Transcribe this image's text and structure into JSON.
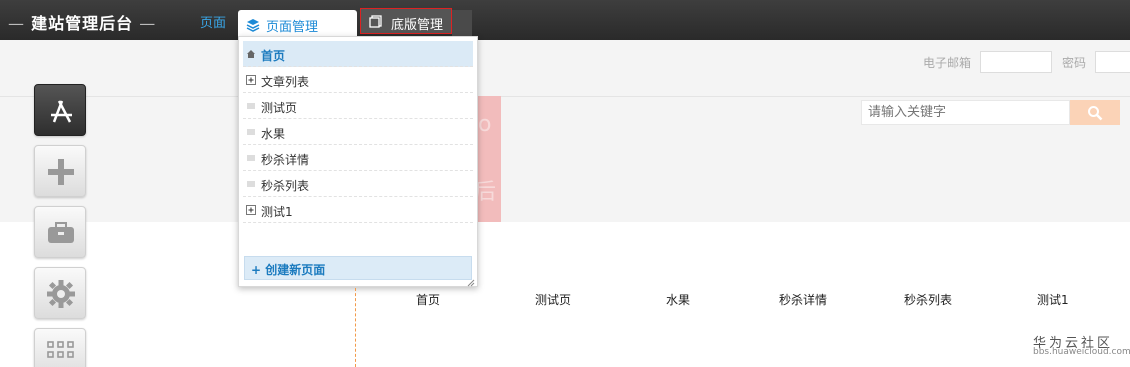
{
  "header": {
    "app_title": "建站管理后台",
    "page_link": "页面",
    "tab_pages": "页面管理",
    "tab_base": "底版管理"
  },
  "login": {
    "email_label": "电子邮箱",
    "password_label": "密码"
  },
  "search": {
    "placeholder": "请输入关键字"
  },
  "dropdown": {
    "items": [
      {
        "label": "首页",
        "icon": "home-icon",
        "active": true
      },
      {
        "label": "文章列表",
        "icon": "expand-plus-icon"
      },
      {
        "label": "测试页",
        "icon": "drag-lines-icon"
      },
      {
        "label": "水果",
        "icon": "drag-lines-icon"
      },
      {
        "label": "秒杀详情",
        "icon": "drag-lines-icon"
      },
      {
        "label": "秒杀列表",
        "icon": "drag-lines-icon"
      },
      {
        "label": "测试1",
        "icon": "expand-plus-icon"
      }
    ],
    "create_label": "+ 创建新页面"
  },
  "nav": {
    "items": [
      "首页",
      "测试页",
      "水果",
      "秒杀详情",
      "秒杀列表",
      "测试1"
    ]
  },
  "watermark": {
    "cn": "华为云社区",
    "url": "bbs.huaweicloud.com"
  },
  "colors": {
    "topbar": "#333333",
    "accent_blue": "#1c8ad6",
    "highlight_red": "#dd2222",
    "search_btn": "#fbd3b7"
  }
}
